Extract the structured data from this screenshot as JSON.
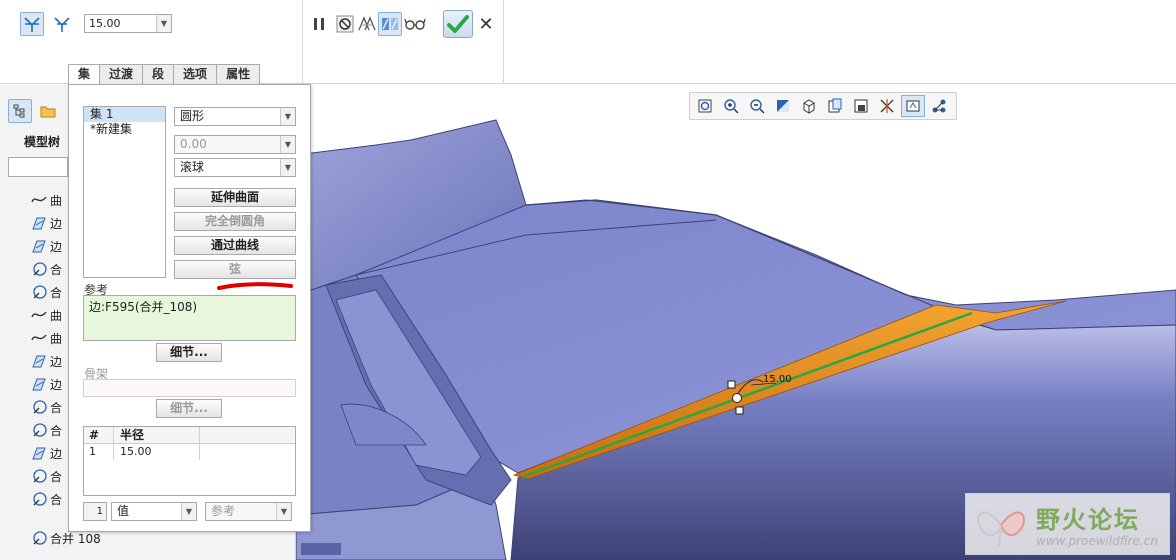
{
  "dashboard": {
    "value": "15.00",
    "tabs": [
      "集",
      "过渡",
      "段",
      "选项",
      "属性"
    ],
    "active_tab": "集"
  },
  "model_tree": {
    "title": "模型树",
    "items": [
      "曲",
      "边",
      "边",
      "合",
      "合",
      "曲",
      "曲",
      "边",
      "边",
      "合",
      "合",
      "边",
      "合",
      "合",
      "合并 108"
    ]
  },
  "sets": {
    "list": [
      "集 1",
      "*新建集"
    ],
    "shape": "圆形",
    "value": "0.00",
    "method": "滚球",
    "btn_extend": "延伸曲面",
    "btn_full_round": "完全倒圆角",
    "btn_through_curve": "通过曲线",
    "btn_chord": "弦",
    "ref_label": "参考",
    "ref_value": "边:F595(合并_108)",
    "details_label": "细节...",
    "skeleton_label": "骨架",
    "table_headers": [
      "#",
      "半径"
    ],
    "table_rows": [
      [
        "1",
        "15.00"
      ]
    ],
    "spin_value": "1",
    "value_mode": "值",
    "ref_mode": "参考"
  },
  "viewport": {
    "dimension": "15.00"
  },
  "watermark": {
    "title": "野火论坛",
    "url": "www.proewildfire.cn"
  },
  "colors": {
    "model_blue": "#7f88cf",
    "fillet_orange": "#e98a1c",
    "accent_green": "#27a844",
    "highlight_red": "#e00000"
  }
}
